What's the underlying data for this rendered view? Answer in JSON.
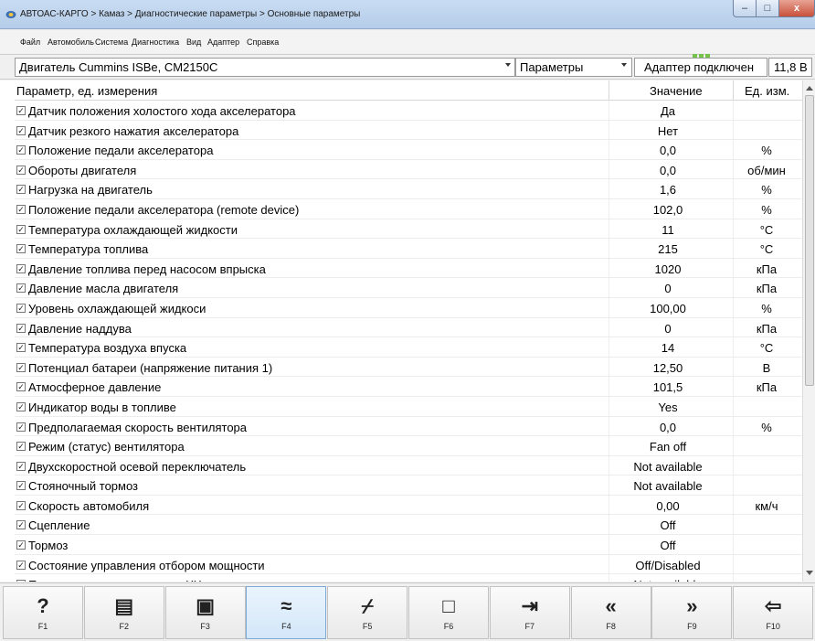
{
  "window": {
    "title": "АВТОАС-КАРГО > Камаз > Диагностические параметры > Основные параметры",
    "controls": {
      "minimize": "–",
      "maximize": "□",
      "close": "x"
    }
  },
  "menu": [
    "Файл",
    "Автомобиль",
    "Система",
    "Диагностика",
    "Вид",
    "Адаптер",
    "Справка"
  ],
  "header": {
    "engine": "Двигатель Cummins ISBe, CM2150C",
    "mode": "Параметры",
    "adapter_status": "Адаптер подключен",
    "voltage": "11,8 В"
  },
  "table": {
    "columns": {
      "name": "Параметр, ед. измерения",
      "value": "Значение",
      "unit": "Ед. изм."
    },
    "rows": [
      {
        "name": "Датчик положения холостого хода акселератора",
        "value": "Да",
        "unit": ""
      },
      {
        "name": "Датчик резкого нажатия акселератора",
        "value": "Нет",
        "unit": ""
      },
      {
        "name": "Положение педали акселератора",
        "value": "0,0",
        "unit": "%"
      },
      {
        "name": "Обороты двигателя",
        "value": "0,0",
        "unit": "об/мин"
      },
      {
        "name": "Нагрузка на двигатель",
        "value": "1,6",
        "unit": "%"
      },
      {
        "name": "Положение педали акселератора (remote device)",
        "value": "102,0",
        "unit": "%"
      },
      {
        "name": "Температура охлаждающей жидкости",
        "value": "11",
        "unit": "°C"
      },
      {
        "name": "Температура топлива",
        "value": "215",
        "unit": "°C"
      },
      {
        "name": "Давление топлива перед насосом впрыска",
        "value": "1020",
        "unit": "кПа"
      },
      {
        "name": "Давление масла двигателя",
        "value": "0",
        "unit": "кПа"
      },
      {
        "name": "Уровень охлаждающей жидкоси",
        "value": "100,00",
        "unit": "%"
      },
      {
        "name": "Давление наддува",
        "value": "0",
        "unit": "кПа"
      },
      {
        "name": "Температура воздуха впуска",
        "value": "14",
        "unit": "°C"
      },
      {
        "name": "Потенциал батареи (напряжение питания 1)",
        "value": "12,50",
        "unit": "В"
      },
      {
        "name": "Атмосферное давление",
        "value": "101,5",
        "unit": "кПа"
      },
      {
        "name": "Индикатор воды в топливе",
        "value": "Yes",
        "unit": ""
      },
      {
        "name": "Предполагаемая скорость вентилятора",
        "value": "0,0",
        "unit": "%"
      },
      {
        "name": "Режим (статус) вентилятора",
        "value": "Fan off",
        "unit": ""
      },
      {
        "name": "Двухскоростной осевой переключатель",
        "value": "Not available",
        "unit": ""
      },
      {
        "name": "Стояночный тормоз",
        "value": "Not available",
        "unit": ""
      },
      {
        "name": "Скорость автомобиля",
        "value": "0,00",
        "unit": "км/ч"
      },
      {
        "name": "Сцепление",
        "value": "Off",
        "unit": ""
      },
      {
        "name": "Тормоз",
        "value": "Off",
        "unit": ""
      },
      {
        "name": "Состояние управления отбором мощности",
        "value": "Off/Disabled",
        "unit": ""
      },
      {
        "name": "Переключатель увеличения XX",
        "value": "Not available",
        "unit": ""
      }
    ]
  },
  "fkeys": [
    {
      "label": "F1",
      "icon": "help-icon",
      "glyph": "?"
    },
    {
      "label": "F2",
      "icon": "report-icon",
      "glyph": "▤"
    },
    {
      "label": "F3",
      "icon": "save-icon",
      "glyph": "▣"
    },
    {
      "label": "F4",
      "icon": "graph-icon",
      "glyph": "≈"
    },
    {
      "label": "F5",
      "icon": "broom-icon",
      "glyph": "⌿"
    },
    {
      "label": "F6",
      "icon": "stop-icon",
      "glyph": "□"
    },
    {
      "label": "F7",
      "icon": "import-icon",
      "glyph": "⇥"
    },
    {
      "label": "F8",
      "icon": "previous-icon",
      "glyph": "«"
    },
    {
      "label": "F9",
      "icon": "next-icon",
      "glyph": "»"
    },
    {
      "label": "F10",
      "icon": "exit-icon",
      "glyph": "⇦"
    }
  ],
  "active_fkey": "F4"
}
